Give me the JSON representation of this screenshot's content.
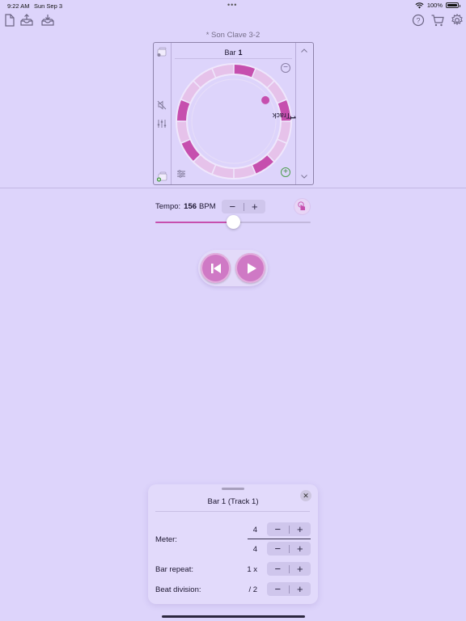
{
  "status_bar": {
    "time": "9:22 AM",
    "date": "Sun Sep 3",
    "battery": "100%"
  },
  "toolbar": {
    "left_icons": [
      "new-document-icon",
      "import-icon",
      "export-icon"
    ],
    "right_icons": [
      "help-icon",
      "cart-icon",
      "gear-icon"
    ]
  },
  "document": {
    "title": "* Son Clave 3-2"
  },
  "editor": {
    "bar_label": "Bar",
    "bar_number": "1",
    "track_label": "Track",
    "track_number": "1",
    "beats": 16,
    "active_beats": [
      0,
      3,
      6,
      10,
      12
    ],
    "playhead_beat": 2
  },
  "tempo": {
    "label": "Tempo:",
    "value": "156",
    "unit": "BPM",
    "minus": "−",
    "plus": "+",
    "slider_fraction": 0.5
  },
  "colors": {
    "accent": "#c64fae",
    "background": "#ddd4fb",
    "ring_light": "#e6c2ea"
  },
  "sheet": {
    "title": "Bar 1 (Track 1)",
    "close": "✕",
    "rows": {
      "meter_label": "Meter:",
      "meter_top": "4",
      "meter_bottom": "4",
      "bar_repeat_label": "Bar repeat:",
      "bar_repeat_value": "1 x",
      "beat_division_label": "Beat division:",
      "beat_division_value": "/ 2"
    },
    "minus": "−",
    "plus": "+"
  }
}
